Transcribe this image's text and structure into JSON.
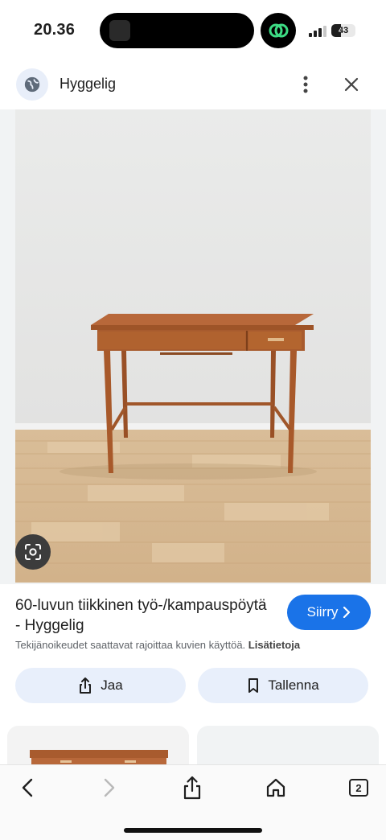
{
  "status_bar": {
    "time": "20.36",
    "battery": "43"
  },
  "header": {
    "site_name": "Hyggelig"
  },
  "result": {
    "title": "60-luvun tiikkinen työ-/kampauspöytä - Hyggelig",
    "visit_label": "Siirry",
    "notice": "Tekijänoikeudet saattavat rajoittaa kuvien käyttöä.",
    "notice_link": "Lisätietoja",
    "share_label": "Jaa",
    "save_label": "Tallenna"
  },
  "toolbar": {
    "tab_count": "2"
  },
  "icons": [
    "globe-icon",
    "more-vert-icon",
    "close-icon",
    "lens-icon",
    "chevron-right-icon",
    "share-icon",
    "bookmark-icon",
    "back-icon",
    "forward-icon",
    "home-icon",
    "tabs-icon"
  ]
}
